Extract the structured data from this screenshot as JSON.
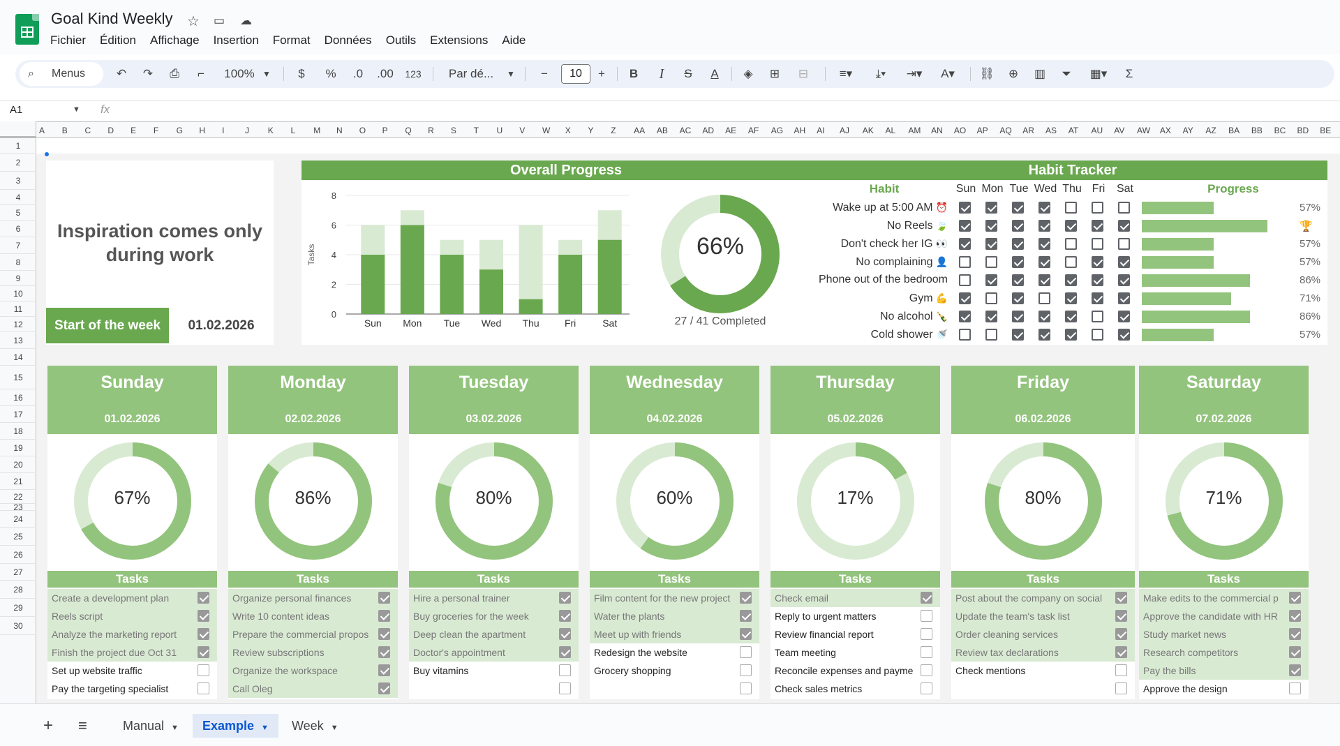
{
  "app": {
    "title": "Goal Kind Weekly"
  },
  "menu": [
    "Fichier",
    "Édition",
    "Affichage",
    "Insertion",
    "Format",
    "Données",
    "Outils",
    "Extensions",
    "Aide"
  ],
  "toolbar": {
    "search_label": "Menus",
    "zoom": "100%",
    "currency": "$",
    "percent": "%",
    "dec_less": ".0",
    "dec_more": ".00",
    "number_format": "123",
    "font": "Par dé...",
    "font_size": "10"
  },
  "formula": {
    "cell_ref": "A1",
    "fx": "fx"
  },
  "columns": [
    "A",
    "B",
    "C",
    "D",
    "E",
    "F",
    "G",
    "H",
    "I",
    "J",
    "K",
    "L",
    "M",
    "N",
    "O",
    "P",
    "Q",
    "R",
    "S",
    "T",
    "U",
    "V",
    "W",
    "X",
    "Y",
    "Z",
    "AA",
    "AB",
    "AC",
    "AD",
    "AE",
    "AF",
    "AG",
    "AH",
    "AI",
    "AJ",
    "AK",
    "AL",
    "AM",
    "AN",
    "AO",
    "AP",
    "AQ",
    "AR",
    "AS",
    "AT",
    "AU",
    "AV",
    "AW",
    "AX",
    "AY",
    "AZ",
    "BA",
    "BB",
    "BC",
    "BD",
    "BE"
  ],
  "rows": [
    "1",
    "2",
    "3",
    "4",
    "5",
    "6",
    "7",
    "8",
    "9",
    "10",
    "11",
    "12",
    "13",
    "14",
    "15",
    "16",
    "17",
    "18",
    "19",
    "20",
    "21",
    "22",
    "23",
    "24",
    "25",
    "26",
    "27",
    "28",
    "29",
    "30"
  ],
  "quote": {
    "line1": "Inspiration comes only",
    "line2": "during work"
  },
  "week": {
    "label": "Start of the week",
    "date": "01.02.2026"
  },
  "overall": {
    "title": "Overall Progress",
    "percent_label": "66%",
    "percent": 0.66,
    "completed_label": "27 / 41 Completed",
    "colors": {
      "done": "#6aa84f",
      "total": "#d9ead3"
    }
  },
  "chart_data": {
    "type": "bar",
    "title": "",
    "ylabel": "Tasks",
    "xlabel": "",
    "ylim": [
      0,
      8
    ],
    "yticks": [
      0,
      2,
      4,
      6,
      8
    ],
    "categories": [
      "Sun",
      "Mon",
      "Tue",
      "Wed",
      "Thu",
      "Fri",
      "Sat"
    ],
    "series": [
      {
        "values": [
          6,
          7,
          5,
          5,
          6,
          5,
          7
        ]
      },
      {
        "values": [
          4,
          6,
          4,
          3,
          1,
          4,
          5
        ]
      }
    ]
  },
  "habit": {
    "title": "Habit Tracker",
    "habit_header": "Habit",
    "progress_header": "Progress",
    "days": [
      "Sun",
      "Mon",
      "Tue",
      "Wed",
      "Thu",
      "Fri",
      "Sat"
    ],
    "rows": [
      {
        "name": "Wake up at 5:00 AM",
        "icon": "alarm-clock-icon",
        "glyph": "⏰",
        "checks": [
          1,
          1,
          1,
          1,
          0,
          0,
          0
        ],
        "progress": 0.57,
        "pct": "57%"
      },
      {
        "name": "No Reels",
        "icon": "leaf-icon",
        "glyph": "🍃",
        "checks": [
          1,
          1,
          1,
          1,
          1,
          1,
          1
        ],
        "progress": 1.0,
        "pct": "🏆"
      },
      {
        "name": "Don't check her IG",
        "icon": "eyes-icon",
        "glyph": "👀",
        "checks": [
          1,
          1,
          1,
          1,
          0,
          0,
          0
        ],
        "progress": 0.57,
        "pct": "57%"
      },
      {
        "name": "No complaining",
        "icon": "person-icon",
        "glyph": "👤",
        "checks": [
          0,
          0,
          1,
          1,
          0,
          1,
          1
        ],
        "progress": 0.57,
        "pct": "57%"
      },
      {
        "name": "Phone out of the bedroom",
        "icon": "",
        "glyph": "",
        "checks": [
          0,
          1,
          1,
          1,
          1,
          1,
          1
        ],
        "progress": 0.86,
        "pct": "86%"
      },
      {
        "name": "Gym",
        "icon": "flexed-arm-icon",
        "glyph": "💪",
        "checks": [
          1,
          0,
          1,
          0,
          1,
          1,
          1
        ],
        "progress": 0.71,
        "pct": "71%"
      },
      {
        "name": "No alcohol",
        "icon": "bottle-icon",
        "glyph": "🍾",
        "checks": [
          1,
          1,
          1,
          1,
          1,
          0,
          1
        ],
        "progress": 0.86,
        "pct": "86%"
      },
      {
        "name": "Cold shower",
        "icon": "shower-icon",
        "glyph": "🚿",
        "checks": [
          0,
          0,
          1,
          1,
          1,
          0,
          1
        ],
        "progress": 0.57,
        "pct": "57%"
      }
    ]
  },
  "days": [
    {
      "name": "Sunday",
      "date": "01.02.2026",
      "pct": "67%",
      "progress": 0.67,
      "tasks_label": "Tasks",
      "tasks": [
        {
          "text": "Create a development plan",
          "done": true
        },
        {
          "text": "Reels script",
          "done": true
        },
        {
          "text": "Analyze the marketing report",
          "done": true
        },
        {
          "text": "Finish the project due Oct 31",
          "done": true
        },
        {
          "text": "Set up website traffic",
          "done": false
        },
        {
          "text": "Pay the targeting specialist",
          "done": false
        }
      ]
    },
    {
      "name": "Monday",
      "date": "02.02.2026",
      "pct": "86%",
      "progress": 0.86,
      "tasks_label": "Tasks",
      "tasks": [
        {
          "text": "Organize personal finances",
          "done": true
        },
        {
          "text": "Write 10 content ideas",
          "done": true
        },
        {
          "text": "Prepare the commercial propos",
          "done": true
        },
        {
          "text": "Review subscriptions",
          "done": true
        },
        {
          "text": "Organize the workspace",
          "done": true
        },
        {
          "text": "Call Oleg",
          "done": true
        }
      ]
    },
    {
      "name": "Tuesday",
      "date": "03.02.2026",
      "pct": "80%",
      "progress": 0.8,
      "tasks_label": "Tasks",
      "tasks": [
        {
          "text": "Hire a personal trainer",
          "done": true
        },
        {
          "text": "Buy groceries for the week",
          "done": true
        },
        {
          "text": "Deep clean the apartment",
          "done": true
        },
        {
          "text": "Doctor's appointment",
          "done": true
        },
        {
          "text": "Buy vitamins",
          "done": false
        },
        {
          "text": "",
          "done": false
        }
      ]
    },
    {
      "name": "Wednesday",
      "date": "04.02.2026",
      "pct": "60%",
      "progress": 0.6,
      "tasks_label": "Tasks",
      "tasks": [
        {
          "text": "Film content for the new project",
          "done": true
        },
        {
          "text": "Water the plants",
          "done": true
        },
        {
          "text": "Meet up with friends",
          "done": true
        },
        {
          "text": "Redesign the website",
          "done": false
        },
        {
          "text": "Grocery shopping",
          "done": false
        },
        {
          "text": "",
          "done": false
        }
      ]
    },
    {
      "name": "Thursday",
      "date": "05.02.2026",
      "pct": "17%",
      "progress": 0.17,
      "tasks_label": "Tasks",
      "tasks": [
        {
          "text": "Check email",
          "done": true
        },
        {
          "text": "Reply to urgent matters",
          "done": false
        },
        {
          "text": "Review financial report",
          "done": false
        },
        {
          "text": "Team meeting",
          "done": false
        },
        {
          "text": "Reconcile expenses and payme",
          "done": false
        },
        {
          "text": "Check sales metrics",
          "done": false
        }
      ]
    },
    {
      "name": "Friday",
      "date": "06.02.2026",
      "pct": "80%",
      "progress": 0.8,
      "tasks_label": "Tasks",
      "tasks": [
        {
          "text": "Post about the company on social",
          "done": true
        },
        {
          "text": "Update the team's task list",
          "done": true
        },
        {
          "text": "Order cleaning services",
          "done": true
        },
        {
          "text": "Review tax declarations",
          "done": true
        },
        {
          "text": "Check mentions",
          "done": false
        },
        {
          "text": "",
          "done": false
        }
      ]
    },
    {
      "name": "Saturday",
      "date": "07.02.2026",
      "pct": "71%",
      "progress": 0.71,
      "tasks_label": "Tasks",
      "tasks": [
        {
          "text": "Make edits to the commercial p",
          "done": true
        },
        {
          "text": "Approve the candidate with HR",
          "done": true
        },
        {
          "text": "Study market news",
          "done": true
        },
        {
          "text": "Research competitors",
          "done": true
        },
        {
          "text": "Pay the bills",
          "done": true
        },
        {
          "text": "Approve the design",
          "done": false
        }
      ]
    }
  ],
  "day_colors": {
    "ring": "#93c47d",
    "ring_bg": "#d9ead3"
  },
  "sheets": [
    {
      "label": "Manual",
      "active": false
    },
    {
      "label": "Example",
      "active": true
    },
    {
      "label": "Week",
      "active": false
    }
  ]
}
